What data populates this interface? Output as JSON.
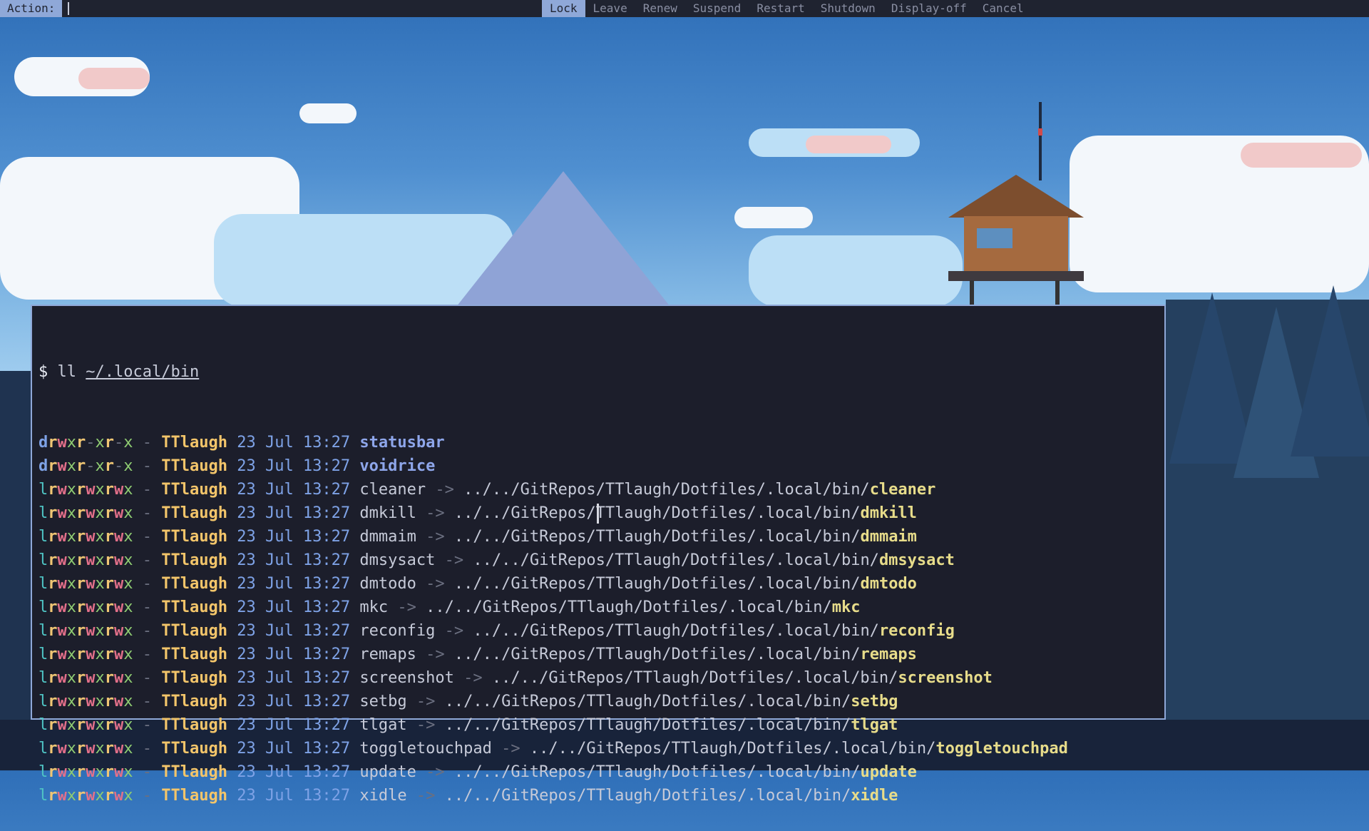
{
  "topbar": {
    "prompt_label": "Action:",
    "input_value": "",
    "options": [
      "Lock",
      "Leave",
      "Renew",
      "Suspend",
      "Restart",
      "Shutdown",
      "Display-off",
      "Cancel"
    ],
    "selected": "Lock"
  },
  "terminal": {
    "prompt_symbol": "$",
    "command": "ll",
    "argument": "~/.local/bin",
    "entries": [
      {
        "perm": "drwxr-xr-x",
        "size": "-",
        "user": "TTlaugh",
        "date": "23 Jul 13:27",
        "name": "statusbar",
        "target_dir": "",
        "target_file": ""
      },
      {
        "perm": "drwxr-xr-x",
        "size": "-",
        "user": "TTlaugh",
        "date": "23 Jul 13:27",
        "name": "voidrice",
        "target_dir": "",
        "target_file": ""
      },
      {
        "perm": "lrwxrwxrwx",
        "size": "-",
        "user": "TTlaugh",
        "date": "23 Jul 13:27",
        "name": "cleaner",
        "target_dir": "../../GitRepos/TTlaugh/Dotfiles/.local/bin/",
        "target_file": "cleaner"
      },
      {
        "perm": "lrwxrwxrwx",
        "size": "-",
        "user": "TTlaugh",
        "date": "23 Jul 13:27",
        "name": "dmkill",
        "target_dir": "../../GitRepos/TTlaugh/Dotfiles/.local/bin/",
        "target_file": "dmkill"
      },
      {
        "perm": "lrwxrwxrwx",
        "size": "-",
        "user": "TTlaugh",
        "date": "23 Jul 13:27",
        "name": "dmmaim",
        "target_dir": "../../GitRepos/TTlaugh/Dotfiles/.local/bin/",
        "target_file": "dmmaim"
      },
      {
        "perm": "lrwxrwxrwx",
        "size": "-",
        "user": "TTlaugh",
        "date": "23 Jul 13:27",
        "name": "dmsysact",
        "target_dir": "../../GitRepos/TTlaugh/Dotfiles/.local/bin/",
        "target_file": "dmsysact"
      },
      {
        "perm": "lrwxrwxrwx",
        "size": "-",
        "user": "TTlaugh",
        "date": "23 Jul 13:27",
        "name": "dmtodo",
        "target_dir": "../../GitRepos/TTlaugh/Dotfiles/.local/bin/",
        "target_file": "dmtodo"
      },
      {
        "perm": "lrwxrwxrwx",
        "size": "-",
        "user": "TTlaugh",
        "date": "23 Jul 13:27",
        "name": "mkc",
        "target_dir": "../../GitRepos/TTlaugh/Dotfiles/.local/bin/",
        "target_file": "mkc"
      },
      {
        "perm": "lrwxrwxrwx",
        "size": "-",
        "user": "TTlaugh",
        "date": "23 Jul 13:27",
        "name": "reconfig",
        "target_dir": "../../GitRepos/TTlaugh/Dotfiles/.local/bin/",
        "target_file": "reconfig"
      },
      {
        "perm": "lrwxrwxrwx",
        "size": "-",
        "user": "TTlaugh",
        "date": "23 Jul 13:27",
        "name": "remaps",
        "target_dir": "../../GitRepos/TTlaugh/Dotfiles/.local/bin/",
        "target_file": "remaps"
      },
      {
        "perm": "lrwxrwxrwx",
        "size": "-",
        "user": "TTlaugh",
        "date": "23 Jul 13:27",
        "name": "screenshot",
        "target_dir": "../../GitRepos/TTlaugh/Dotfiles/.local/bin/",
        "target_file": "screenshot"
      },
      {
        "perm": "lrwxrwxrwx",
        "size": "-",
        "user": "TTlaugh",
        "date": "23 Jul 13:27",
        "name": "setbg",
        "target_dir": "../../GitRepos/TTlaugh/Dotfiles/.local/bin/",
        "target_file": "setbg"
      },
      {
        "perm": "lrwxrwxrwx",
        "size": "-",
        "user": "TTlaugh",
        "date": "23 Jul 13:27",
        "name": "tlgat",
        "target_dir": "../../GitRepos/TTlaugh/Dotfiles/.local/bin/",
        "target_file": "tlgat"
      },
      {
        "perm": "lrwxrwxrwx",
        "size": "-",
        "user": "TTlaugh",
        "date": "23 Jul 13:27",
        "name": "toggletouchpad",
        "target_dir": "../../GitRepos/TTlaugh/Dotfiles/.local/bin/",
        "target_file": "toggletouchpad"
      },
      {
        "perm": "lrwxrwxrwx",
        "size": "-",
        "user": "TTlaugh",
        "date": "23 Jul 13:27",
        "name": "update",
        "target_dir": "../../GitRepos/TTlaugh/Dotfiles/.local/bin/",
        "target_file": "update"
      },
      {
        "perm": "lrwxrwxrwx",
        "size": "-",
        "user": "TTlaugh",
        "date": "23 Jul 13:27",
        "name": "xidle",
        "target_dir": "../../GitRepos/TTlaugh/Dotfiles/.local/bin/",
        "target_file": "xidle"
      }
    ]
  },
  "colors": {
    "bar_bg": "#1f2330",
    "accent": "#8fa8d8",
    "terminal_bg": "#1c1e2b",
    "user": "#f3c56a",
    "symlink_target": "#e7dc8a",
    "directory": "#8ea6ea"
  }
}
